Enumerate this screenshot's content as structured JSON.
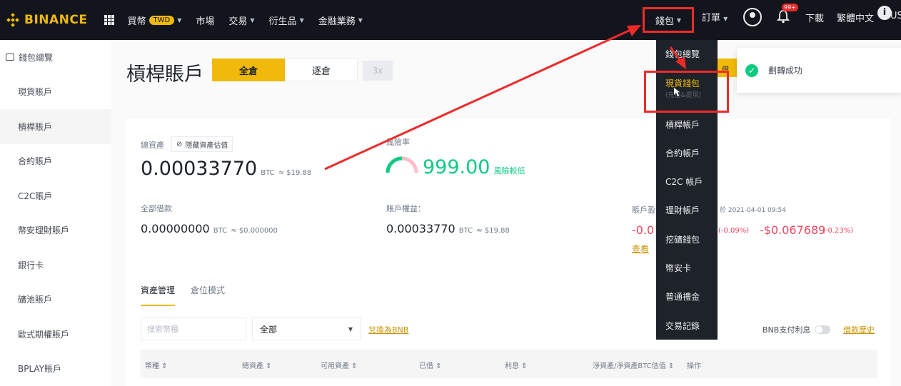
{
  "brand": {
    "name": "BINANCE",
    "color": "#f0b90b"
  },
  "topnav": {
    "items": [
      {
        "label": "買幣",
        "badge": "TWD",
        "caret": true
      },
      {
        "label": "市場",
        "caret": false
      },
      {
        "label": "交易",
        "caret": true
      },
      {
        "label": "衍生品",
        "caret": true
      },
      {
        "label": "金融業務",
        "caret": true
      }
    ],
    "wallet": "錢包",
    "orders": "訂單",
    "bell_count": "99+",
    "download": "下載",
    "language": "繁體中文",
    "currency": "USD",
    "info": "i"
  },
  "sidebar": {
    "items": [
      "錢包總覽",
      "現貨賬戶",
      "槓桿賬戶",
      "合約賬戶",
      "C2C賬戶",
      "幣安理財賬戶",
      "銀行卡",
      "礦池賬戶",
      "歐式期權賬戶",
      "BPLAY賬戶"
    ]
  },
  "page": {
    "title": "槓桿賬戶",
    "modes": [
      "全倉",
      "逐倉"
    ],
    "leverage": "3x"
  },
  "summary": {
    "total_label": "總資產",
    "hide_btn": "隱藏資產估值",
    "total_value": "0.00033770",
    "total_unit": "BTC",
    "total_usd": "≈ $19.88",
    "risk_label": "風險率",
    "risk_value": "999.00",
    "risk_level": "風險較低",
    "borrowed_label": "全部借款",
    "borrowed_value": "0.00000000",
    "borrowed_unit": "BTC",
    "borrowed_usd": "≈ $0.000000",
    "equity_label": "賬戶權益：",
    "equity_value": "0.00033770",
    "equity_unit": "BTC",
    "equity_usd": "≈ $19.88",
    "pnl_label": "賬戶盈",
    "pnl_time": "於 2021-04-01 09:54",
    "pnl1_value": "-0.0",
    "pnl1_pct": "(-0.09%)",
    "pnl2_value": "-$0.067689",
    "pnl2_pct": "(-0.23%)",
    "view_link": "查看"
  },
  "assets": {
    "tabs": [
      "資產管理",
      "倉位模式"
    ],
    "search_placeholder": "搜索幣種",
    "filter_value": "全部",
    "convert_link": "兌換為BNB",
    "bnb_pay": "BNB支付利息",
    "history_link": "借款歷史",
    "columns": [
      "幣種 ⇕",
      "總資產 ⇕",
      "可用資產 ⇕",
      "已借 ⇕",
      "利息 ⇕",
      "淨資產/淨資產BTC估值 ⇕",
      "操作"
    ]
  },
  "wallet_menu": {
    "items": [
      "錢包總覽",
      "現貨錢包",
      "槓桿帳戶",
      "合約帳戶",
      "C2C 帳戶",
      "理財帳戶",
      "挖礦錢包",
      "幣安卡",
      "普通禮金",
      "交易記錄"
    ],
    "sub_text": "(充值&提現)"
  },
  "toast": {
    "text": "劃轉成功",
    "peek": "借"
  },
  "colors": {
    "accent": "#f0b90b",
    "up": "#0ecb81",
    "down": "#f6465d",
    "annotation": "#ee2a2a"
  }
}
